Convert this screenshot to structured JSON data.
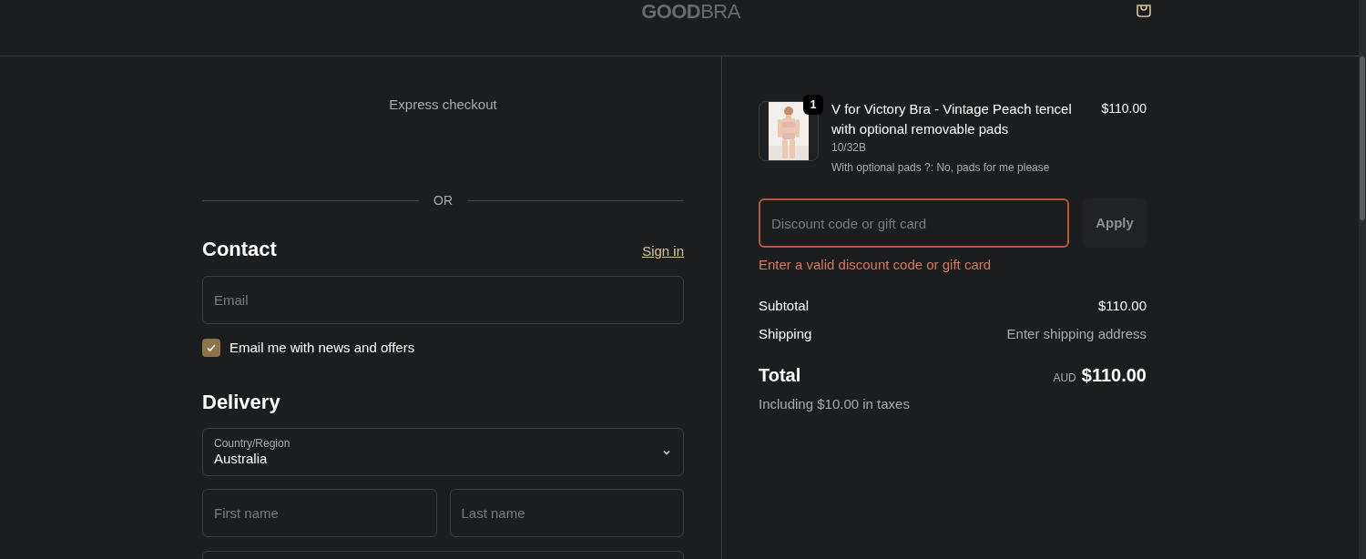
{
  "header": {
    "logo": "**GOOD**BRA"
  },
  "express_checkout": {
    "title": "Express checkout",
    "divider": "OR"
  },
  "contact": {
    "heading": "Contact",
    "sign_in": "Sign in",
    "email": {
      "placeholder": "Email"
    },
    "newsletter": {
      "label": "Email me with news and offers",
      "checked": true
    }
  },
  "delivery": {
    "heading": "Delivery",
    "country": {
      "label": "Country/Region",
      "value": "Australia"
    },
    "first_name": {
      "placeholder": "First name"
    },
    "last_name": {
      "placeholder": "Last name"
    }
  },
  "order": {
    "items": [
      {
        "title": "V for Victory Bra - Vintage Peach tencel with optional removable pads",
        "quantity": "1",
        "variant": "10/32B",
        "option": "With optional pads ?: No, pads for me please",
        "price": "$110.00"
      }
    ],
    "discount": {
      "placeholder": "Discount code or gift card",
      "invalid": true,
      "error": "Enter a valid discount code or gift card",
      "button": "Apply"
    },
    "subtotal": {
      "label": "Subtotal",
      "value": "$110.00"
    },
    "shipping": {
      "label": "Shipping",
      "value": "Enter shipping address"
    },
    "total": {
      "label": "Total",
      "currency": "AUD",
      "value": "$110.00"
    },
    "taxes": "Including $10.00 in taxes"
  }
}
